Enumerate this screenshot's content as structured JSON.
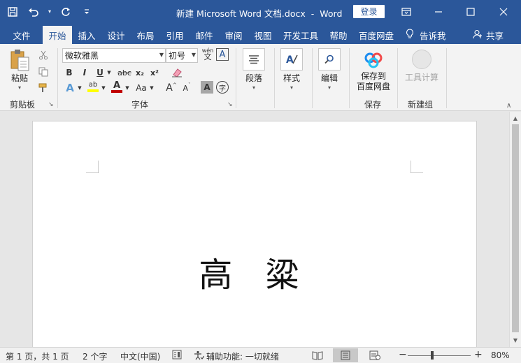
{
  "titlebar": {
    "document_title": "新建 Microsoft Word 文档.docx",
    "separator": "-",
    "app_name": "Word",
    "login_label": "登录"
  },
  "tabs": [
    {
      "label": "文件"
    },
    {
      "label": "开始",
      "active": true
    },
    {
      "label": "插入"
    },
    {
      "label": "设计"
    },
    {
      "label": "布局"
    },
    {
      "label": "引用"
    },
    {
      "label": "邮件"
    },
    {
      "label": "审阅"
    },
    {
      "label": "视图"
    },
    {
      "label": "开发工具"
    },
    {
      "label": "帮助"
    },
    {
      "label": "百度网盘"
    }
  ],
  "tell_me_label": "告诉我",
  "share_label": "共享",
  "ribbon": {
    "clipboard": {
      "paste_label": "粘贴",
      "group_label": "剪贴板"
    },
    "font": {
      "font_name": "微软雅黑",
      "font_size": "初号",
      "group_label": "字体",
      "phonetic_label": "wén",
      "bold": "B",
      "italic": "I",
      "underline": "U",
      "strike": "abc",
      "subscript": "x₂",
      "superscript": "x²",
      "grow": "A",
      "shrink": "A",
      "change_case": "Aa"
    },
    "paragraph": {
      "label": "段落"
    },
    "styles": {
      "label": "样式"
    },
    "editing": {
      "label": "编辑"
    },
    "save": {
      "label_line1": "保存到",
      "label_line2": "百度网盘",
      "group_label": "保存"
    },
    "newgroup": {
      "tool_label": "工具计算",
      "group_label": "新建组"
    }
  },
  "colors": {
    "accent": "#2b579a",
    "highlight": "#ffff00",
    "font_color": "#c00000"
  },
  "document": {
    "text": "高 粱"
  },
  "statusbar": {
    "page_info": "第 1 页，共 1 页",
    "word_count": "2 个字",
    "language": "中文(中国)",
    "accessibility": "辅助功能: 一切就绪",
    "zoom_level": "80%",
    "zoom_minus": "−",
    "zoom_plus": "+",
    "zoom_fraction": 0.8
  }
}
